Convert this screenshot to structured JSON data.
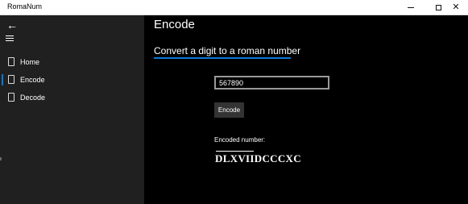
{
  "window": {
    "title": "RomaNum",
    "minimize_glyph": "",
    "maximize_glyph": "",
    "close_glyph": "✕"
  },
  "sidebar": {
    "back_icon": "back-arrow-icon",
    "menu_icon": "hamburger-icon",
    "items": [
      {
        "label": "Home",
        "icon": "page-icon",
        "selected": false
      },
      {
        "label": "Encode",
        "icon": "page-icon",
        "selected": true
      },
      {
        "label": "Decode",
        "icon": "page-icon",
        "selected": false
      }
    ]
  },
  "main": {
    "title": "Encode",
    "subtitle": "Convert a digit to a roman number",
    "input_value": "567890",
    "encode_button": "Encode",
    "result_label": "Encoded number:",
    "result_value": "DLXVIIDCCCXC"
  },
  "colors": {
    "accent": "#0a78d7",
    "sidebar_bg": "#202020",
    "main_bg": "#000000"
  }
}
